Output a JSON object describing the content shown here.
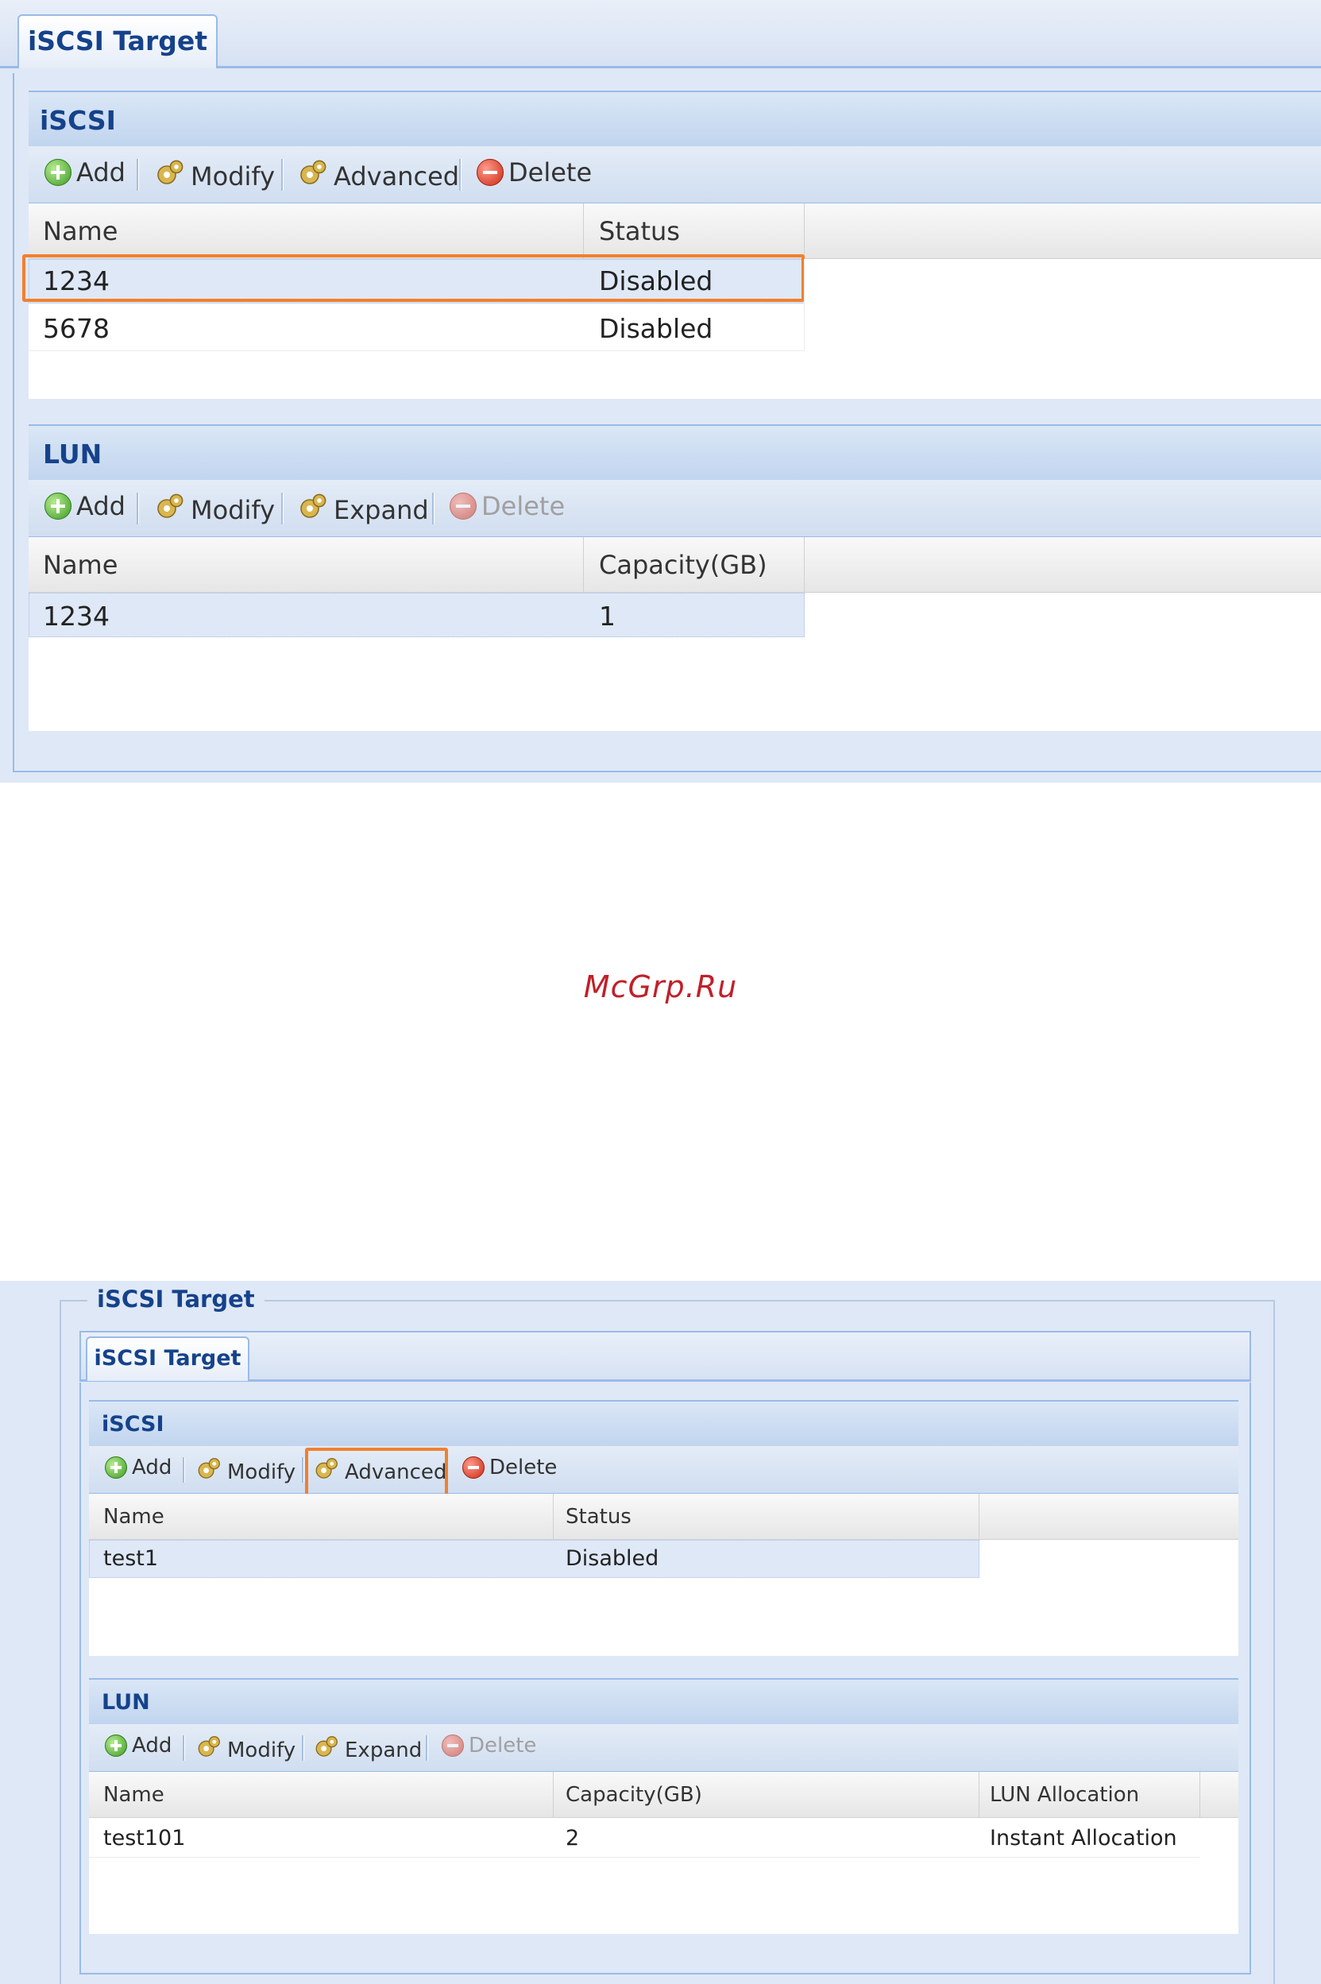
{
  "panel1": {
    "tab_label": "iSCSI Target",
    "iscsi": {
      "title": "iSCSI",
      "toolbar": {
        "add": "Add",
        "modify": "Modify",
        "advanced": "Advanced",
        "delete": "Delete"
      },
      "columns": [
        "Name",
        "Status"
      ],
      "rows": [
        {
          "name": "1234",
          "status": "Disabled",
          "highlighted": true
        },
        {
          "name": "5678",
          "status": "Disabled",
          "highlighted": false
        }
      ]
    },
    "lun": {
      "title": "LUN",
      "toolbar": {
        "add": "Add",
        "modify": "Modify",
        "expand": "Expand",
        "delete": "Delete"
      },
      "columns": [
        "Name",
        "Capacity(GB)"
      ],
      "rows": [
        {
          "name": "1234",
          "capacity": "1"
        }
      ]
    }
  },
  "watermark": "McGrp.Ru",
  "panel2": {
    "legend": "iSCSI Target",
    "tab_label": "iSCSI Target",
    "iscsi": {
      "title": "iSCSI",
      "toolbar": {
        "add": "Add",
        "modify": "Modify",
        "advanced": "Advanced",
        "delete": "Delete"
      },
      "columns": [
        "Name",
        "Status"
      ],
      "rows": [
        {
          "name": "test1",
          "status": "Disabled"
        }
      ]
    },
    "lun": {
      "title": "LUN",
      "toolbar": {
        "add": "Add",
        "modify": "Modify",
        "expand": "Expand",
        "delete": "Delete"
      },
      "columns": [
        "Name",
        "Capacity(GB)",
        "LUN Allocation"
      ],
      "rows": [
        {
          "name": "test101",
          "capacity": "2",
          "allocation": "Instant Allocation"
        }
      ]
    }
  },
  "colors": {
    "highlight": "#f08030",
    "header_text": "#15428b",
    "panel_bg": "#dfe8f6",
    "watermark": "#c0202a"
  },
  "icons": {
    "add": "add-circle-icon",
    "modify": "gear-icon",
    "advanced": "gear-icon",
    "expand": "gear-icon",
    "delete": "delete-circle-icon"
  }
}
